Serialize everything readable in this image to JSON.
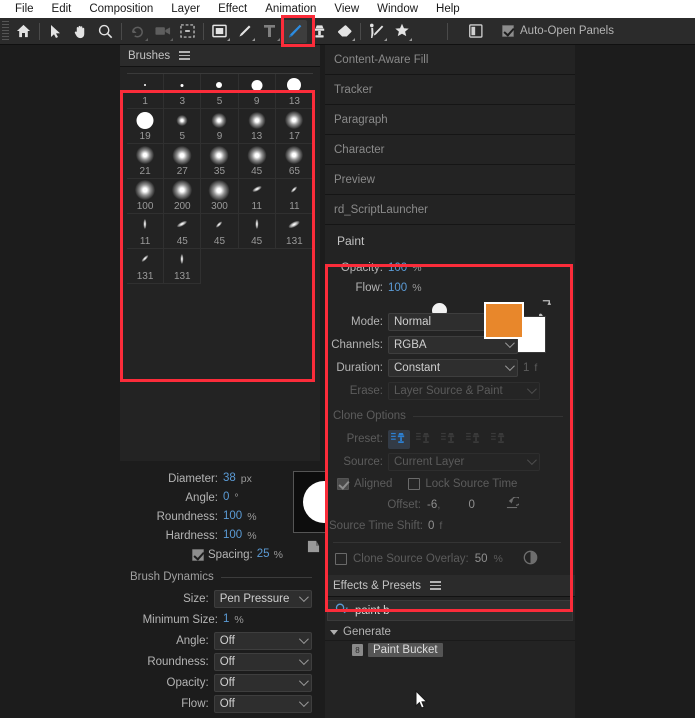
{
  "menubar": {
    "items": [
      "File",
      "Edit",
      "Composition",
      "Layer",
      "Effect",
      "Animation",
      "View",
      "Window",
      "Help"
    ]
  },
  "toolbar": {
    "tools": [
      {
        "name": "home-icon",
        "selected": false
      },
      {
        "name": "selection-arrow-icon",
        "selected": false
      },
      {
        "name": "hand-icon",
        "selected": false
      },
      {
        "name": "zoom-magnifier-icon",
        "selected": false
      },
      {
        "name": "orbit-rotate-icon",
        "selected": false
      },
      {
        "name": "camera-icon",
        "selected": false
      },
      {
        "name": "region-of-interest-icon",
        "selected": false
      },
      {
        "name": "shape-rectangle-icon",
        "selected": false
      },
      {
        "name": "pen-icon",
        "selected": false
      },
      {
        "name": "type-tool-icon",
        "selected": false
      },
      {
        "name": "brush-icon",
        "selected": true
      },
      {
        "name": "clone-stamp-icon",
        "selected": false
      },
      {
        "name": "eraser-icon",
        "selected": false
      },
      {
        "name": "roto-brush-icon",
        "selected": false
      },
      {
        "name": "puppet-pin-icon",
        "selected": false
      }
    ],
    "workspace_icon": "workspace-panel-icon",
    "auto_open_panels": {
      "label": "Auto-Open Panels",
      "checked": true
    }
  },
  "brushes_panel": {
    "title": "Brushes",
    "menu_icon": "hamburger-menu-icon",
    "brushes": [
      {
        "size": "1",
        "dot": 2,
        "soft": false
      },
      {
        "size": "3",
        "dot": 3,
        "soft": false
      },
      {
        "size": "5",
        "dot": 6,
        "soft": false
      },
      {
        "size": "9",
        "dot": 11,
        "soft": false
      },
      {
        "size": "13",
        "dot": 14,
        "soft": false
      },
      {
        "size": "19",
        "dot": 17,
        "soft": false
      },
      {
        "size": "5",
        "dot": 3,
        "soft": true
      },
      {
        "size": "9",
        "dot": 7,
        "soft": true
      },
      {
        "size": "13",
        "dot": 9,
        "soft": true
      },
      {
        "size": "17",
        "dot": 10,
        "soft": true
      },
      {
        "size": "21",
        "dot": 10,
        "soft": true
      },
      {
        "size": "27",
        "dot": 11,
        "soft": true
      },
      {
        "size": "35",
        "dot": 11,
        "soft": true
      },
      {
        "size": "45",
        "dot": 11,
        "soft": true
      },
      {
        "size": "65",
        "dot": 10,
        "soft": true
      },
      {
        "size": "100",
        "dot": 12,
        "soft": true
      },
      {
        "size": "200",
        "dot": 12,
        "soft": true
      },
      {
        "size": "300",
        "dot": 13,
        "soft": true
      },
      {
        "size": "11",
        "dot": 10,
        "soft": true,
        "shape": "slash-a"
      },
      {
        "size": "11",
        "dot": 10,
        "soft": true,
        "shape": "slash-b"
      },
      {
        "size": "11",
        "dot": 10,
        "soft": true,
        "shape": "vert"
      },
      {
        "size": "45",
        "dot": 11,
        "soft": true,
        "shape": "slash-a"
      },
      {
        "size": "45",
        "dot": 10,
        "soft": true,
        "shape": "slash-b"
      },
      {
        "size": "45",
        "dot": 10,
        "soft": true,
        "shape": "vert"
      },
      {
        "size": "131",
        "dot": 12,
        "soft": true,
        "shape": "slash-a"
      },
      {
        "size": "131",
        "dot": 11,
        "soft": true,
        "shape": "slash-b"
      },
      {
        "size": "131",
        "dot": 10,
        "soft": true,
        "shape": "vert"
      }
    ]
  },
  "brush_properties": {
    "diameter": {
      "label": "Diameter:",
      "value": "38",
      "unit": "px"
    },
    "angle": {
      "label": "Angle:",
      "value": "0",
      "unit": "°"
    },
    "roundness": {
      "label": "Roundness:",
      "value": "100",
      "unit": "%"
    },
    "hardness": {
      "label": "Hardness:",
      "value": "100",
      "unit": "%"
    },
    "spacing": {
      "label": "Spacing:",
      "value": "25",
      "unit": "%",
      "checked": true
    },
    "new_brush_icon": "new-brush-icon",
    "delete_brush_icon": "delete-brush-trash-icon"
  },
  "brush_dynamics": {
    "title": "Brush Dynamics",
    "rows": [
      {
        "label": "Size:",
        "value": "Pen Pressure",
        "type": "select"
      },
      {
        "label": "Minimum Size:",
        "value": "1",
        "unit": "%",
        "type": "number"
      },
      {
        "label": "Angle:",
        "value": "Off",
        "type": "select"
      },
      {
        "label": "Roundness:",
        "value": "Off",
        "type": "select"
      },
      {
        "label": "Opacity:",
        "value": "Off",
        "type": "select"
      },
      {
        "label": "Flow:",
        "value": "Off",
        "type": "select"
      }
    ]
  },
  "collapsed_panels": [
    "Content-Aware Fill",
    "Tracker",
    "Paragraph",
    "Character",
    "Preview",
    "rd_ScriptLauncher"
  ],
  "paint_panel": {
    "title": "Paint",
    "opacity": {
      "label": "Opacity:",
      "value": "100",
      "unit": "%"
    },
    "flow": {
      "label": "Flow:",
      "value": "100",
      "unit": "%"
    },
    "brush_size_indicator": "38",
    "foreground_color": "#e8872b",
    "background_color": "#ffffff",
    "swap_colors_icon": "swap-colors-icon",
    "default_colors_icon": "default-colors-icon",
    "eyedropper_icon": "eyedropper-icon",
    "mode": {
      "label": "Mode:",
      "value": "Normal",
      "disabled": false
    },
    "channels": {
      "label": "Channels:",
      "value": "RGBA",
      "disabled": false
    },
    "duration": {
      "label": "Duration:",
      "value": "Constant",
      "disabled": false,
      "frames": "1",
      "frames_unit": "f"
    },
    "erase": {
      "label": "Erase:",
      "value": "Layer Source & Paint",
      "disabled": true
    },
    "clone_options": {
      "title": "Clone Options",
      "preset": {
        "label": "Preset:",
        "count": 5,
        "selected_index": 0,
        "icon": "clone-stamp-preset-icon"
      },
      "source": {
        "label": "Source:",
        "value": "Current Layer",
        "disabled": true
      },
      "aligned": {
        "label": "Aligned",
        "checked": true,
        "disabled": true
      },
      "lock_source_time": {
        "label": "Lock Source Time",
        "checked": false,
        "disabled": true
      },
      "offset": {
        "label": "Offset:",
        "x": "-6",
        "y": "0",
        "reset_icon": "reset-arrow-icon"
      },
      "source_time_shift": {
        "label": "Source Time Shift:",
        "value": "0",
        "unit": "f"
      },
      "clone_source_overlay": {
        "label": "Clone Source Overlay:",
        "checked": false,
        "value": "50",
        "unit": "%",
        "icon": "overlay-toggle-icon"
      }
    }
  },
  "effects_panel": {
    "title": "Effects & Presets",
    "menu_icon": "hamburger-menu-icon",
    "search": {
      "icon": "search-icon",
      "value": "paint b",
      "placeholder": "Search"
    },
    "category": {
      "label": "Generate",
      "expanded": true
    },
    "results": [
      {
        "label": "Paint Bucket",
        "icon": "effect-icon",
        "selected": true
      }
    ]
  },
  "highlights": {
    "color": "#fb2c3a"
  }
}
